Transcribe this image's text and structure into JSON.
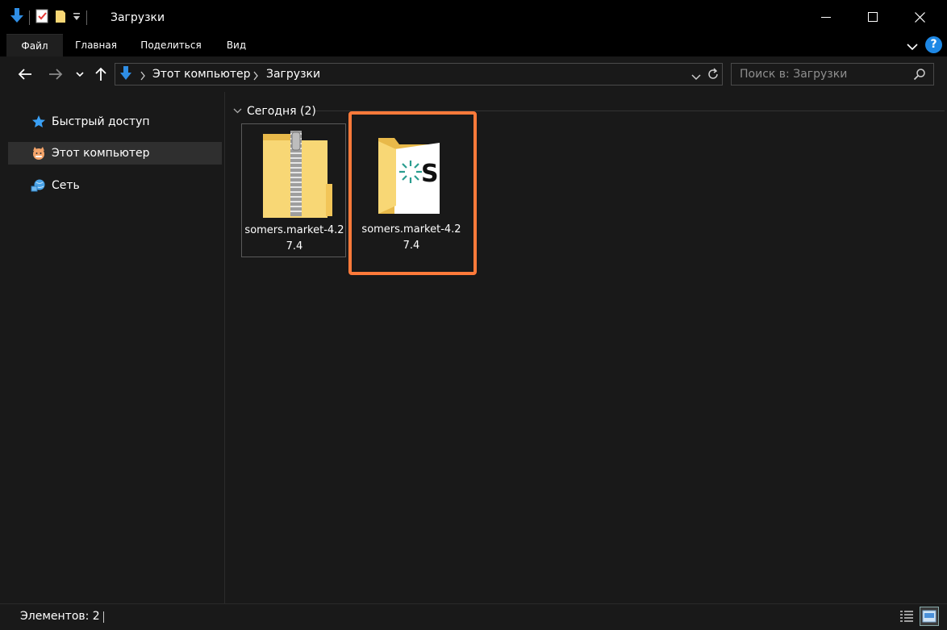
{
  "window": {
    "title": "Загрузки"
  },
  "ribbon": {
    "tabs": [
      {
        "label": "Файл"
      },
      {
        "label": "Главная"
      },
      {
        "label": "Поделиться"
      },
      {
        "label": "Вид"
      }
    ],
    "help_label": "?"
  },
  "address": {
    "crumbs": [
      "Этот компьютер",
      "Загрузки"
    ]
  },
  "search": {
    "placeholder": "Поиск в: Загрузки"
  },
  "sidebar": {
    "items": [
      {
        "label": "Быстрый доступ",
        "icon": "star-icon"
      },
      {
        "label": "Этот компьютер",
        "icon": "computer-icon"
      },
      {
        "label": "Сеть",
        "icon": "network-icon"
      }
    ]
  },
  "content": {
    "group_label": "Сегодня (2)",
    "files": [
      {
        "name": "somers.market-4.27.4",
        "icon": "zip-folder-icon"
      },
      {
        "name": "somers.market-4.27.4",
        "icon": "app-folder-icon"
      }
    ]
  },
  "status": {
    "count_text": "Элементов: 2"
  },
  "colors": {
    "background": "#191919",
    "titlebar": "#000000",
    "highlight": "#ff7a3a",
    "folder": "#f8d775",
    "accent_blue": "#1e88e5"
  }
}
